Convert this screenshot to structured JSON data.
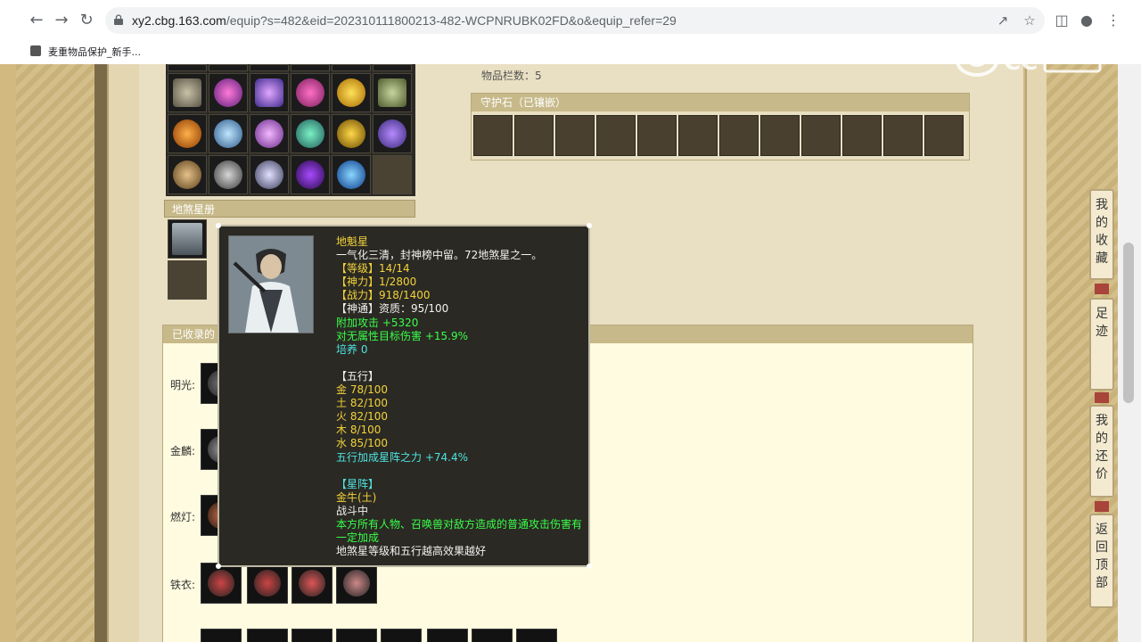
{
  "browser": {
    "url_host": "xy2.cbg.163.com",
    "url_rest": "/equip?s=482&eid=202310111800213-482-WCPNRUBK02FD&o&equip_refer=29",
    "bookmark_label": "麦重物品保护_新手..."
  },
  "top_info": {
    "items_count": "物品栏数：5"
  },
  "stone_panel": {
    "title": "守护石（已镶嵌）",
    "slots": 12
  },
  "star_book": {
    "title": "地煞星册"
  },
  "collect_panel": {
    "title": "已收录的",
    "rows": [
      {
        "label": "明光:"
      },
      {
        "label": "金麟:"
      },
      {
        "label": "燃灯:"
      },
      {
        "label": "铁衣:"
      }
    ]
  },
  "tooltip": {
    "lines": [
      {
        "text": "地魁星",
        "color": "gold"
      },
      {
        "text": "一气化三清，封神榜中留。72地煞星之一。",
        "color": "white"
      },
      {
        "text": "【等级】14/14",
        "color": "gold"
      },
      {
        "text": "【神力】1/2800",
        "color": "gold"
      },
      {
        "text": "【战力】918/1400",
        "color": "gold"
      },
      {
        "text": "【神通】资质：95/100",
        "color": "white"
      },
      {
        "text": "附加攻击 +5320",
        "color": "green"
      },
      {
        "text": "对无属性目标伤害 +15.9%",
        "color": "green"
      },
      {
        "text": "培养 0",
        "color": "cyan"
      },
      {
        "text": "",
        "color": "white"
      },
      {
        "text": "【五行】",
        "color": "white"
      },
      {
        "text": "金 78/100",
        "color": "gold"
      },
      {
        "text": "土 82/100",
        "color": "gold"
      },
      {
        "text": "火 82/100",
        "color": "gold"
      },
      {
        "text": "木 8/100",
        "color": "gold"
      },
      {
        "text": "水 85/100",
        "color": "gold"
      },
      {
        "text": "五行加成星阵之力 +74.4%",
        "color": "cyan"
      },
      {
        "text": "",
        "color": "white"
      },
      {
        "text": "【星阵】",
        "color": "cyan"
      },
      {
        "text": "金牛(土)",
        "color": "gold"
      },
      {
        "text": "战斗中",
        "color": "white"
      },
      {
        "text": "本方所有人物、召唤兽对敌方造成的普通攻击伤害有一定加成",
        "color": "green"
      },
      {
        "text": "地煞星等级和五行越高效果越好",
        "color": "white"
      }
    ]
  },
  "side_buttons": [
    {
      "label": "我的收藏"
    },
    {
      "label": "足迹"
    },
    {
      "label": "我的还价"
    },
    {
      "label": "返回顶部"
    }
  ],
  "colors": {
    "gold": "#f3d23b",
    "white": "#f2f2f2",
    "green": "#39ff4a",
    "cyan": "#4fe3e0"
  }
}
